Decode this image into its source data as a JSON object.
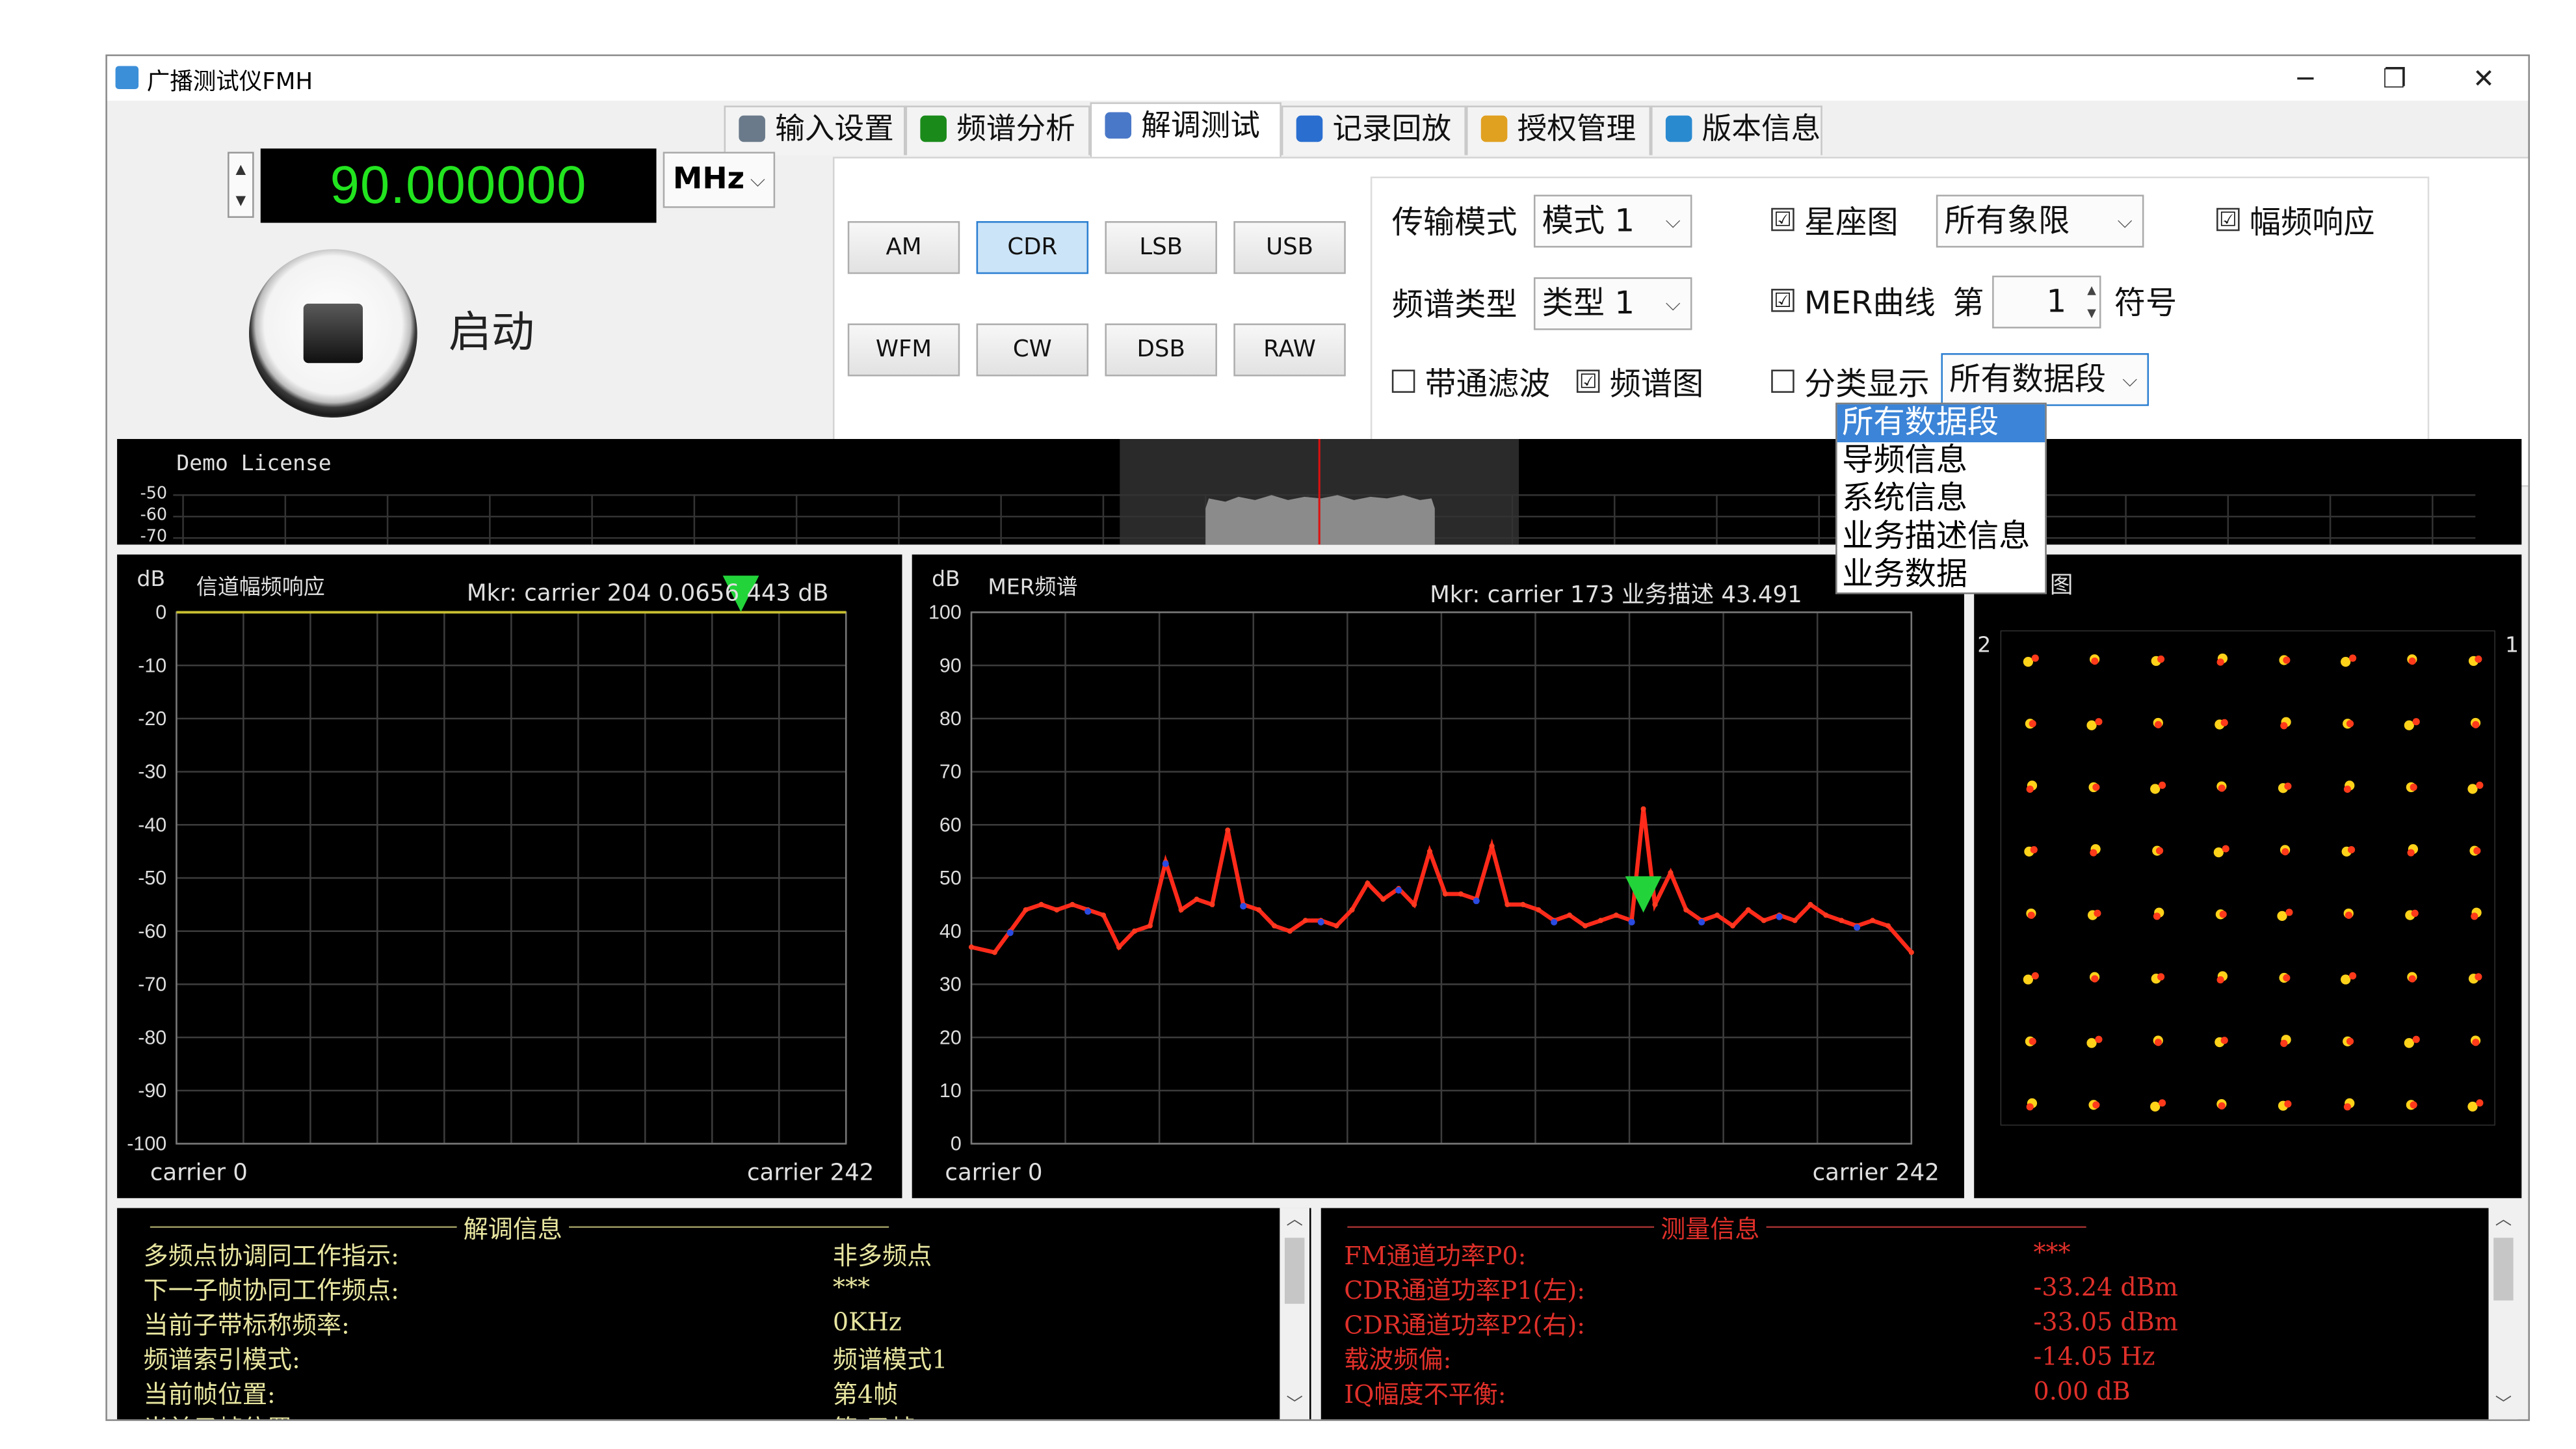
{
  "window": {
    "title": "广播测试仪FMH",
    "minimize": "─",
    "restore": "❐",
    "close": "✕"
  },
  "tabs": [
    {
      "label": "输入设置",
      "icon": "gear-icon"
    },
    {
      "label": "频谱分析",
      "icon": "spectrum-icon"
    },
    {
      "label": "解调测试",
      "icon": "demod-icon",
      "active": true
    },
    {
      "label": "记录回放",
      "icon": "monitor-icon"
    },
    {
      "label": "授权管理",
      "icon": "key-icon"
    },
    {
      "label": "版本信息",
      "icon": "info-icon"
    }
  ],
  "frequency": {
    "value": "90.000000",
    "unit": "MHz",
    "spin_up": "▲",
    "spin_down": "▼"
  },
  "start": {
    "label": "启动"
  },
  "modes": [
    "AM",
    "CDR",
    "LSB",
    "USB",
    "WFM",
    "CW",
    "DSB",
    "RAW"
  ],
  "selected_mode": "CDR",
  "settings": {
    "transmission_mode_label": "传输模式",
    "transmission_mode_value": "模式 1",
    "spectrum_type_label": "频谱类型",
    "spectrum_type_value": "类型 1",
    "bandpass_label": "带通滤波",
    "bandpass_checked": false,
    "spectrogram_label": "频谱图",
    "spectrogram_checked": true,
    "constellation_label": "星座图",
    "constellation_checked": true,
    "quadrant_value": "所有象限",
    "mer_curve_label": "MER曲线",
    "mer_curve_checked": true,
    "symbol_prefix": "第",
    "symbol_value": "1",
    "symbol_suffix": "符号",
    "classify_label": "分类显示",
    "classify_checked": false,
    "classify_value": "所有数据段",
    "amp_freq_label": "幅频响应",
    "amp_freq_checked": true,
    "check_mark": "☑"
  },
  "dropdown_options": [
    "所有数据段",
    "导频信息",
    "系统信息",
    "业务描述信息",
    "业务数据"
  ],
  "spectrum_strip": {
    "license": "Demo License",
    "ticks": [
      "-50",
      "-60",
      "-70"
    ]
  },
  "chart_data": [
    {
      "type": "line",
      "title": "信道幅频响应",
      "ylabel": "dB",
      "marker_text": "Mkr: carrier 204  0.0656  443 dB",
      "x_start_label": "carrier 0",
      "x_end_label": "carrier 242",
      "ylim": [
        -100,
        0
      ],
      "yticks": [
        "0",
        "-10",
        "-20",
        "-30",
        "-40",
        "-50",
        "-60",
        "-70",
        "-80",
        "-90",
        "-100"
      ],
      "series": [
        {
          "x": [
            0,
            242
          ],
          "values": [
            0,
            0
          ]
        }
      ],
      "marker": {
        "carrier": 204,
        "value": 0.0656
      }
    },
    {
      "type": "line",
      "title": "MER频谱",
      "ylabel": "dB",
      "marker_text": "Mkr: carrier  173  业务描述  43.491",
      "x_start_label": "carrier 0",
      "x_end_label": "carrier 242",
      "ylim": [
        0,
        100
      ],
      "yticks": [
        "100",
        "90",
        "80",
        "70",
        "60",
        "50",
        "40",
        "30",
        "20",
        "10",
        "0"
      ],
      "series": [
        {
          "x": [
            0,
            6,
            10,
            14,
            18,
            22,
            26,
            30,
            34,
            38,
            42,
            46,
            50,
            54,
            58,
            62,
            66,
            70,
            74,
            78,
            82,
            86,
            90,
            94,
            98,
            102,
            106,
            110,
            114,
            118,
            122,
            126,
            130,
            134,
            138,
            142,
            146,
            150,
            154,
            158,
            162,
            166,
            170,
            173,
            176,
            180,
            184,
            188,
            192,
            196,
            200,
            204,
            208,
            212,
            216,
            220,
            224,
            228,
            232,
            236,
            242
          ],
          "values": [
            37,
            36,
            40,
            44,
            45,
            44,
            45,
            44,
            43,
            37,
            40,
            41,
            53,
            44,
            46,
            45,
            59,
            45,
            44,
            41,
            40,
            42,
            42,
            41,
            44,
            49,
            46,
            48,
            45,
            55,
            47,
            47,
            46,
            56,
            45,
            45,
            44,
            42,
            43,
            41,
            42,
            43,
            42,
            63,
            45,
            51,
            44,
            42,
            43,
            41,
            44,
            42,
            43,
            42,
            45,
            43,
            42,
            41,
            42,
            41,
            36
          ]
        }
      ],
      "marker": {
        "carrier": 173,
        "value": 43.491
      }
    }
  ],
  "constellation": {
    "left_label": "2",
    "right_label": "1",
    "title_tail": "图"
  },
  "demod_info": {
    "title": "解调信息",
    "rows": [
      {
        "label": "多频点协调同工作指示:",
        "value": "非多频点"
      },
      {
        "label": "下一子帧协同工作频点:",
        "value": "***"
      },
      {
        "label": "当前子带标称频率:",
        "value": "0KHz"
      },
      {
        "label": "频谱索引模式:",
        "value": "频谱模式1"
      },
      {
        "label": "当前帧位置:",
        "value": "第4帧"
      },
      {
        "label": "当前子帧位置:",
        "value": "第 子帧"
      }
    ]
  },
  "measure_info": {
    "title": "测量信息",
    "rows": [
      {
        "label": "FM通道功率P0:",
        "value": "***"
      },
      {
        "label": "CDR通道功率P1(左):",
        "value": "-33.24 dBm"
      },
      {
        "label": "CDR通道功率P2(右):",
        "value": "-33.05 dBm"
      },
      {
        "label": "载波频偏:",
        "value": "-14.05 Hz"
      },
      {
        "label": "IQ幅度不平衡:",
        "value": "0.00   dB"
      }
    ]
  },
  "colors": {
    "accent": "#2c7fd1",
    "trace": "#ff2a1a",
    "freq_text": "#22e41f",
    "grid": "#3c3c3c",
    "info_yellow": "#e8e6a0",
    "info_red": "#e0302a"
  }
}
